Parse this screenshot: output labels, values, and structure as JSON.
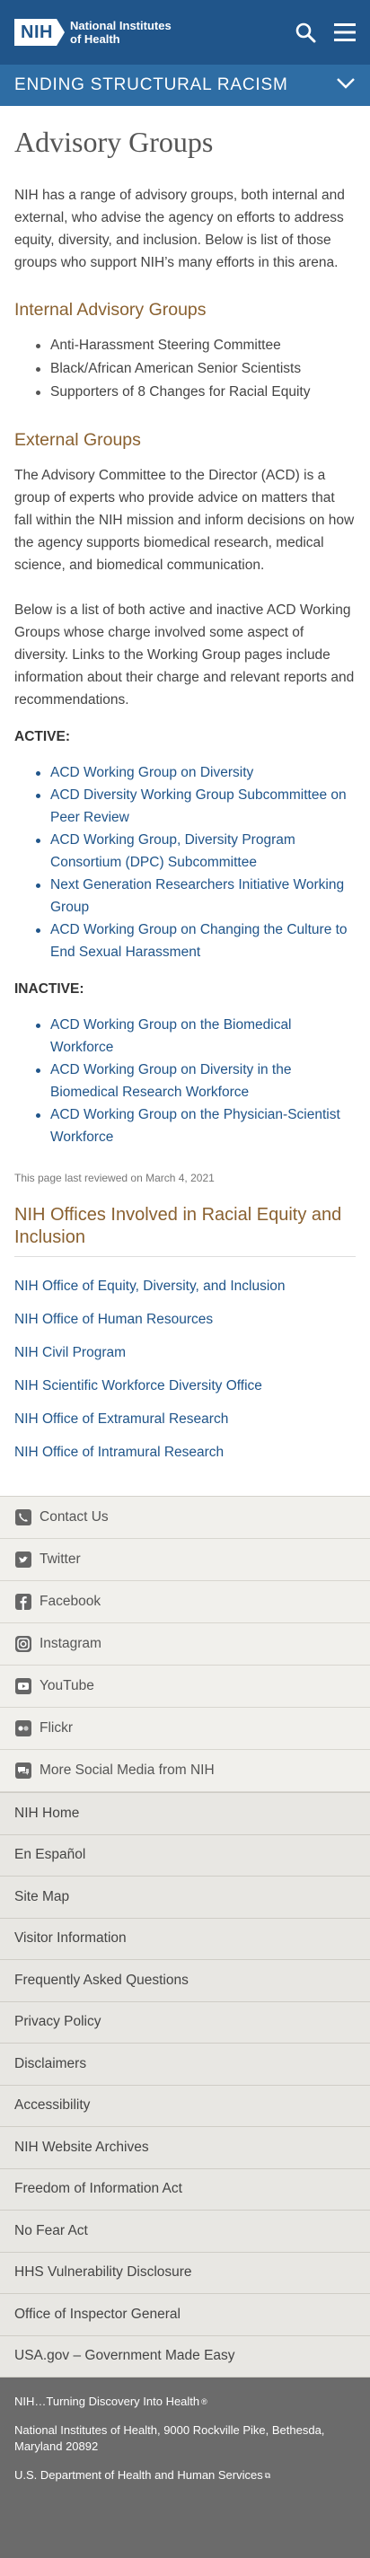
{
  "header": {
    "logo_mark": "NIH",
    "logo_line1": "National Institutes",
    "logo_line2": "of Health",
    "section_title": "ENDING STRUCTURAL RACISM"
  },
  "main": {
    "title": "Advisory Groups",
    "intro": "NIH has a range of advisory groups, both internal and external, who advise the agency on efforts to address equity, diversity, and inclusion. Below is list of those groups who support NIH’s many efforts in this arena.",
    "internal_heading": "Internal Advisory Groups",
    "internal_items": [
      "Anti-Harassment Steering Committee",
      "Black/African American Senior Scientists",
      "Supporters of 8 Changes for Racial Equity"
    ],
    "external_heading": "External Groups",
    "external_p1": "The Advisory Committee to the Director (ACD) is a group of experts who provide advice on matters that fall within the NIH mission and inform decisions on how the agency supports biomedical research, medical science, and biomedical communication.",
    "external_p2": "Below is a list of both active and inactive ACD Working Groups whose charge involved some aspect of diversity. Links to the Working Group pages include information about their charge and relevant reports and recommendations.",
    "active_label": "ACTIVE:",
    "active_items": [
      "ACD Working Group on Diversity",
      "ACD Diversity Working Group Subcommittee on Peer Review",
      "ACD Working Group, Diversity Program Consortium (DPC) Subcommittee",
      "Next Generation Researchers Initiative Working Group",
      "ACD Working Group on Changing the Culture to End Sexual Harassment"
    ],
    "inactive_label": "INACTIVE:",
    "inactive_items": [
      "ACD Working Group on the Biomedical Workforce",
      "ACD Working Group on Diversity in the Biomedical Research Workforce",
      "ACD Working Group on the Physician-Scientist Workforce"
    ],
    "reviewed": "This page last reviewed on March 4, 2021",
    "offices_heading": "NIH Offices Involved in Racial Equity and Inclusion",
    "offices": [
      "NIH Office of Equity, Diversity, and Inclusion",
      "NIH Office of Human Resources",
      "NIH Civil Program",
      "NIH Scientific Workforce Diversity Office",
      "NIH Office of Extramural Research",
      "NIH Office of Intramural Research"
    ]
  },
  "social": [
    {
      "label": "Contact Us",
      "icon": "phone-icon"
    },
    {
      "label": "Twitter",
      "icon": "twitter-icon"
    },
    {
      "label": "Facebook",
      "icon": "facebook-icon"
    },
    {
      "label": "Instagram",
      "icon": "instagram-icon"
    },
    {
      "label": "YouTube",
      "icon": "youtube-icon"
    },
    {
      "label": "Flickr",
      "icon": "flickr-icon"
    },
    {
      "label": "More Social Media from NIH",
      "icon": "chat-icon"
    }
  ],
  "footer_links": [
    "NIH Home",
    "En Español",
    "Site Map",
    "Visitor Information",
    "Frequently Asked Questions",
    "Privacy Policy",
    "Disclaimers",
    "Accessibility",
    "NIH Website Archives",
    "Freedom of Information Act",
    "No Fear Act",
    "HHS Vulnerability Disclosure",
    "Office of Inspector General",
    "USA.gov – Government Made Easy"
  ],
  "bottom": {
    "tagline": "NIH…Turning Discovery Into Health",
    "address": "National Institutes of Health, 9000 Rockville Pike, Bethesda, Maryland 20892",
    "hhs": "U.S. Department of Health and Human Services"
  },
  "colors": {
    "header_bg": "#20558a",
    "section_bar_bg": "#2e6da4",
    "heading_brown": "#8a6130",
    "link_blue": "#20558a",
    "bottom_bg": "#6b6b6b"
  }
}
